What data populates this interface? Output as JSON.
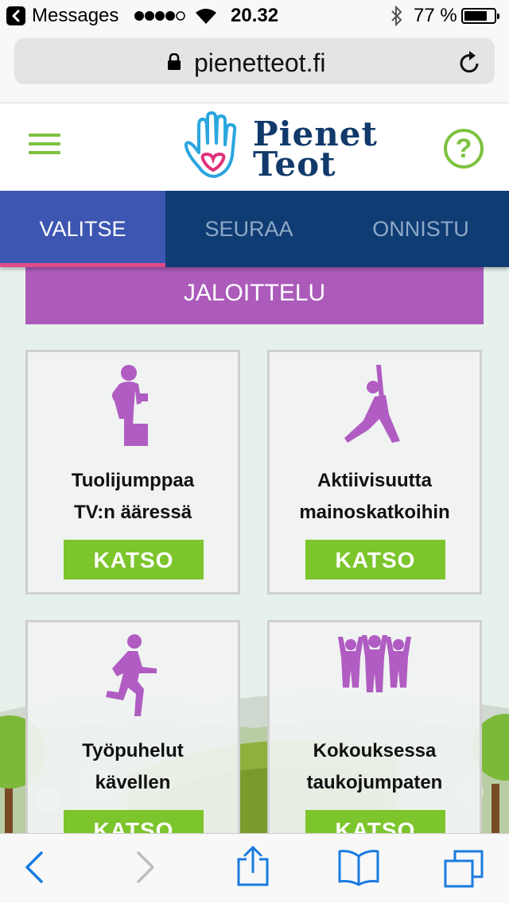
{
  "status_bar": {
    "back_app": "Messages",
    "time": "20.32",
    "battery_percent": "77 %",
    "battery_level": 0.77
  },
  "browser": {
    "url": "pienetteot.fi"
  },
  "header": {
    "logo_word1": "Pienet",
    "logo_word2": "Teot",
    "help_symbol": "?"
  },
  "tabs": [
    {
      "label": "VALITSE",
      "active": true
    },
    {
      "label": "SEURAA",
      "active": false
    },
    {
      "label": "ONNISTU",
      "active": false
    }
  ],
  "category": "JALOITTELU",
  "cards": [
    {
      "icon": "step-exercise-icon",
      "title_line1": "Tuolijumppaa",
      "title_line2": "TV:n ääressä",
      "button": "KATSO"
    },
    {
      "icon": "lunge-stretch-icon",
      "title_line1": "Aktiivisuutta",
      "title_line2": "mainoskatkoihin",
      "button": "KATSO"
    },
    {
      "icon": "walking-person-icon",
      "title_line1": "Työpuhelut",
      "title_line2": "kävellen",
      "button": "KATSO"
    },
    {
      "icon": "group-cheer-icon",
      "title_line1": "Kokouksessa",
      "title_line2": "taukojumpaten",
      "button": "KATSO"
    }
  ],
  "colors": {
    "brand_navy": "#0f3c73",
    "tab_active": "#3d56b2",
    "tab_indicator": "#e14b87",
    "accent_green": "#7dc52c",
    "category_purple": "#ac5bbb",
    "icon_purple": "#b05cc2",
    "content_bg": "#e6f1ec"
  }
}
